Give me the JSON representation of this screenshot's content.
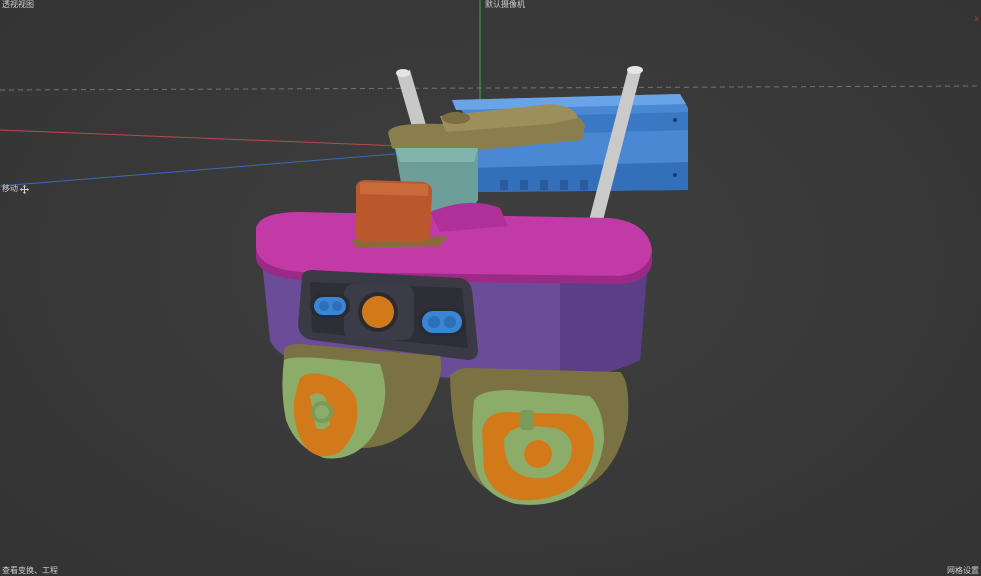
{
  "viewport": {
    "view_name": "透视视图",
    "camera_name": "默认摄像机",
    "move_label": "移动",
    "status_left": "查看变换、工程",
    "status_right": "网格设置",
    "close_mark": "x"
  },
  "colors": {
    "background": "#3a3a3a",
    "axis_x": "#b84a4a",
    "axis_y": "#3aa84a",
    "axis_z": "#3a6ab8",
    "housing_top": "#c03aa8",
    "housing_body": "#6a4a9a",
    "bracket": "#4a8ad8",
    "arm": "#8a7a4a",
    "antenna": "#d0d0d0",
    "dome": "#8aaa6a",
    "lens_orange": "#d07a1a",
    "lens_blue": "#3a8ad8",
    "top_box": "#b8582a",
    "neck": "#6a9a9a"
  }
}
